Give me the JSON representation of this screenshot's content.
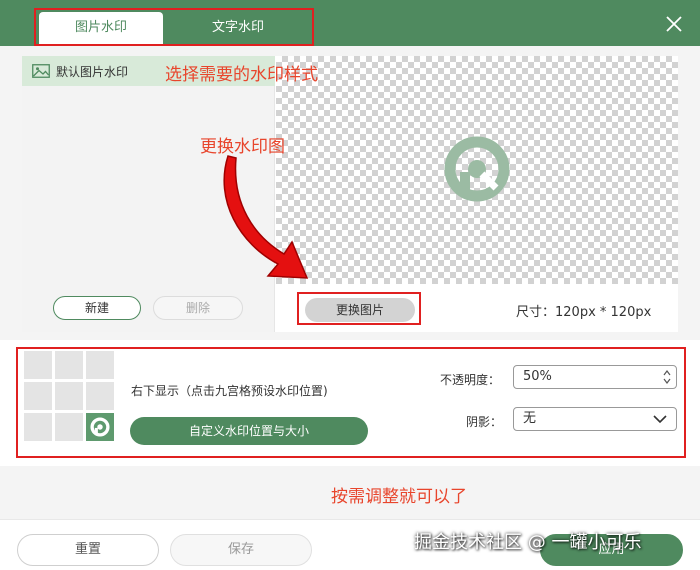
{
  "tabs": [
    {
      "label": "图片水印",
      "active": true
    },
    {
      "label": "文字水印",
      "active": false
    }
  ],
  "library": {
    "item_label": "默认图片水印",
    "new_label": "新建",
    "delete_label": "删除"
  },
  "preview": {
    "replace_label": "更换图片",
    "size_text": "尺寸：120px * 120px"
  },
  "position": {
    "text": "右下显示（点击九宫格预设水印位置)",
    "selected_cell": 9,
    "custom_label": "自定义水印位置与大小"
  },
  "opacity": {
    "label": "不透明度：",
    "value": "50%"
  },
  "shadow": {
    "label": "阴影：",
    "value": "无"
  },
  "footer": {
    "reset_label": "重置",
    "save_label": "保存",
    "apply_label": "应用"
  },
  "annotations": {
    "choose_style": "选择需要的水印样式",
    "replace_image": "更换水印图",
    "adjust": "按需调整就可以了"
  },
  "watermark_text": "掘金技术社区 @ 一罐小可乐",
  "icons": [
    "close-icon",
    "image-icon",
    "watermark-logo-icon",
    "spinner-arrows-icon",
    "chevron-down-icon"
  ],
  "colors": {
    "brand": "#4f8a5f",
    "annotation": "#e02020"
  }
}
